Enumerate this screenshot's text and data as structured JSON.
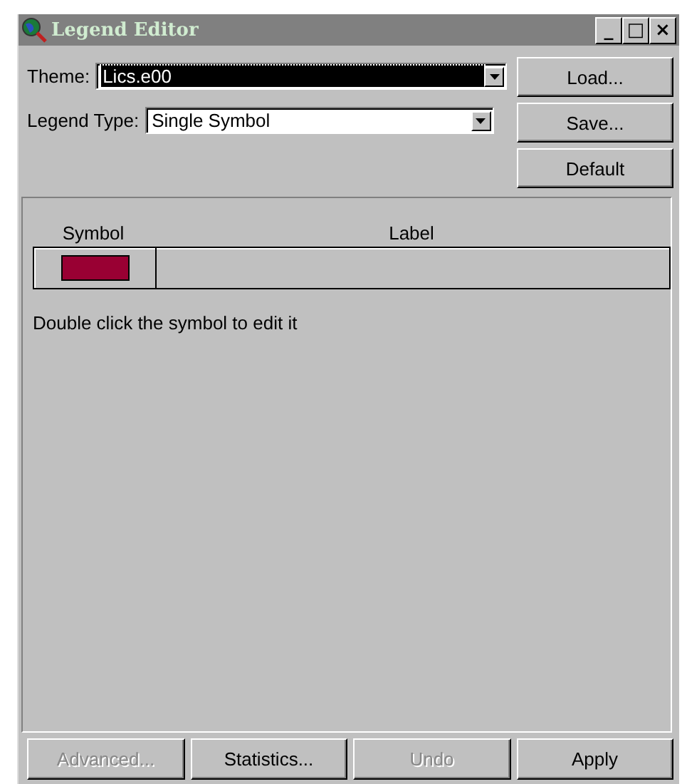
{
  "window": {
    "title": "Legend Editor",
    "controls": [
      "_",
      "□",
      "×"
    ]
  },
  "theme": {
    "label": "Theme:",
    "value": "Lics.e00",
    "focused": true
  },
  "legend_type": {
    "label": "Legend Type:",
    "value": "Single Symbol"
  },
  "side_buttons": [
    {
      "label": "Load...",
      "disabled": false
    },
    {
      "label": "Save...",
      "disabled": false
    },
    {
      "label": "Default",
      "disabled": false
    }
  ],
  "table": {
    "columns": [
      "Symbol",
      "Label"
    ],
    "rows": [
      {
        "color": "#990033"
      }
    ]
  },
  "hint": "Double click the symbol to edit it",
  "bottom_buttons": [
    {
      "label": "Advanced...",
      "disabled": true
    },
    {
      "label": "Statistics...",
      "disabled": false
    },
    {
      "label": "Undo",
      "disabled": true
    },
    {
      "label": "Apply",
      "disabled": false
    }
  ]
}
